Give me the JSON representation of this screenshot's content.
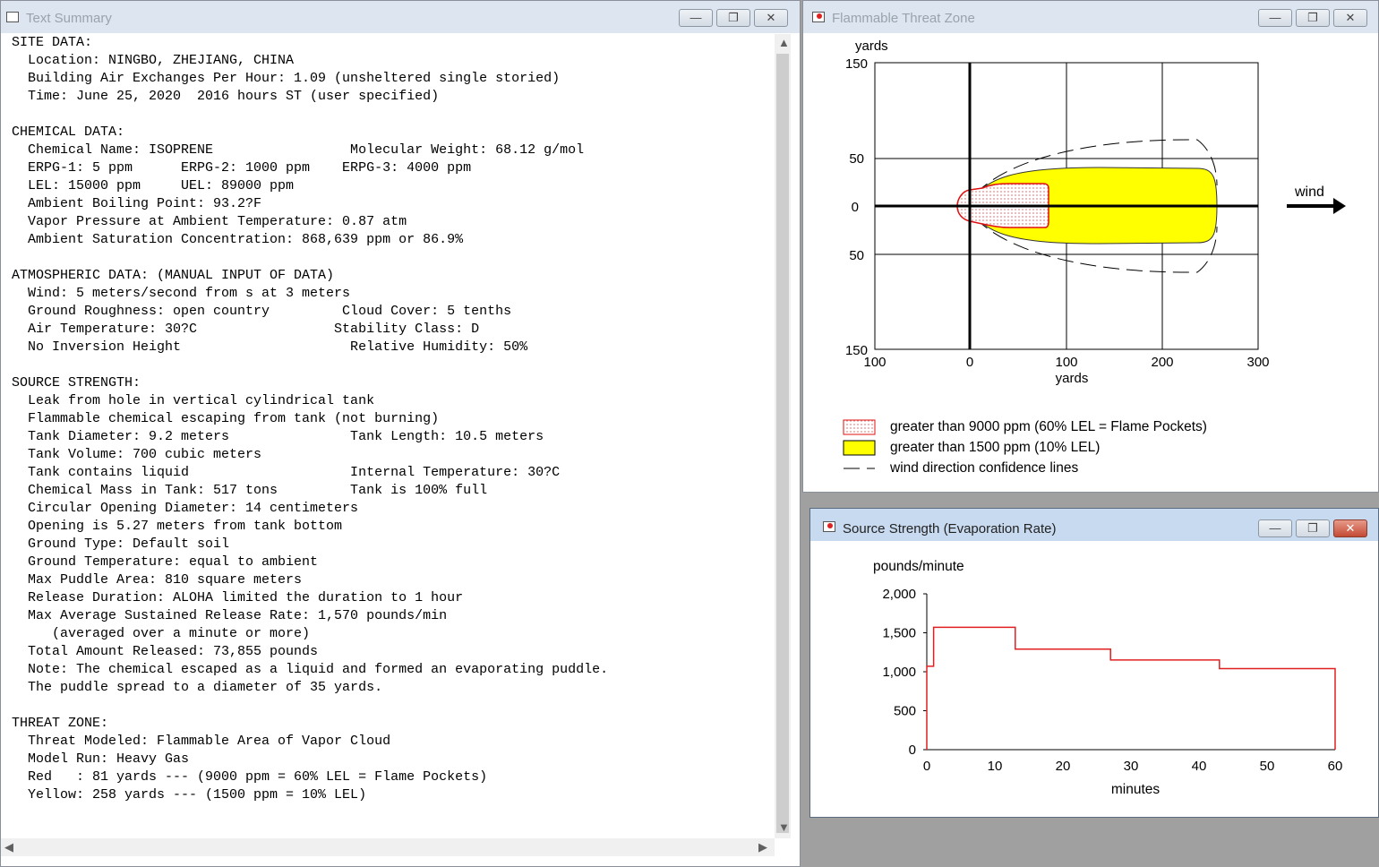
{
  "summary_window": {
    "title": "Text Summary",
    "lines": [
      "SITE DATA:",
      "  Location: NINGBO, ZHEJIANG, CHINA",
      "  Building Air Exchanges Per Hour: 1.09 (unsheltered single storied)",
      "  Time: June 25, 2020  2016 hours ST (user specified)",
      "",
      "CHEMICAL DATA:",
      "  Chemical Name: ISOPRENE                 Molecular Weight: 68.12 g/mol",
      "  ERPG-1: 5 ppm      ERPG-2: 1000 ppm    ERPG-3: 4000 ppm",
      "  LEL: 15000 ppm     UEL: 89000 ppm",
      "  Ambient Boiling Point: 93.2?F",
      "  Vapor Pressure at Ambient Temperature: 0.87 atm",
      "  Ambient Saturation Concentration: 868,639 ppm or 86.9%",
      "",
      "ATMOSPHERIC DATA: (MANUAL INPUT OF DATA)",
      "  Wind: 5 meters/second from s at 3 meters",
      "  Ground Roughness: open country         Cloud Cover: 5 tenths",
      "  Air Temperature: 30?C                 Stability Class: D",
      "  No Inversion Height                     Relative Humidity: 50%",
      "",
      "SOURCE STRENGTH:",
      "  Leak from hole in vertical cylindrical tank",
      "  Flammable chemical escaping from tank (not burning)",
      "  Tank Diameter: 9.2 meters               Tank Length: 10.5 meters",
      "  Tank Volume: 700 cubic meters",
      "  Tank contains liquid                    Internal Temperature: 30?C",
      "  Chemical Mass in Tank: 517 tons         Tank is 100% full",
      "  Circular Opening Diameter: 14 centimeters",
      "  Opening is 5.27 meters from tank bottom",
      "  Ground Type: Default soil",
      "  Ground Temperature: equal to ambient",
      "  Max Puddle Area: 810 square meters",
      "  Release Duration: ALOHA limited the duration to 1 hour",
      "  Max Average Sustained Release Rate: 1,570 pounds/min",
      "     (averaged over a minute or more)",
      "  Total Amount Released: 73,855 pounds",
      "  Note: The chemical escaped as a liquid and formed an evaporating puddle.",
      "  The puddle spread to a diameter of 35 yards.",
      "",
      "THREAT ZONE:",
      "  Threat Modeled: Flammable Area of Vapor Cloud",
      "  Model Run: Heavy Gas",
      "  Red   : 81 yards --- (9000 ppm = 60% LEL = Flame Pockets)",
      "  Yellow: 258 yards --- (1500 ppm = 10% LEL)"
    ]
  },
  "threat_window": {
    "title": "Flammable Threat Zone",
    "y_unit": "yards",
    "x_unit": "yards",
    "y_ticks": [
      "150",
      "50",
      "0",
      "50",
      "150"
    ],
    "x_ticks": [
      "100",
      "0",
      "100",
      "200",
      "300"
    ],
    "wind_label": "wind",
    "legend": [
      {
        "key": "red",
        "label": "greater than 9000 ppm (60% LEL = Flame Pockets)"
      },
      {
        "key": "yellow",
        "label": "greater than 1500 ppm (10% LEL)"
      },
      {
        "key": "dash",
        "label": "wind direction confidence lines"
      }
    ]
  },
  "source_window": {
    "title": "Source Strength (Evaporation Rate)",
    "ylabel": "pounds/minute",
    "xlabel": "minutes",
    "y_ticks": [
      "2,000",
      "1,500",
      "1,000",
      "500",
      "0"
    ],
    "x_ticks": [
      "0",
      "10",
      "20",
      "30",
      "40",
      "50",
      "60"
    ]
  },
  "chart_data": [
    {
      "type": "area",
      "name": "Flammable Threat Zone",
      "x_unit": "yards",
      "y_unit": "yards",
      "xlim": [
        -100,
        300
      ],
      "ylim": [
        -150,
        150
      ],
      "zones": [
        {
          "color": "#ff0000",
          "threshold": "9000 ppm",
          "downwind_extent": 81
        },
        {
          "color": "#ffff00",
          "threshold": "1500 ppm",
          "downwind_extent": 258
        }
      ]
    },
    {
      "type": "line",
      "name": "Source Strength (Evaporation Rate)",
      "xlabel": "minutes",
      "ylabel": "pounds/minute",
      "xlim": [
        0,
        60
      ],
      "ylim": [
        0,
        2000
      ],
      "series": [
        {
          "color": "#e02020",
          "x": [
            0,
            0,
            1,
            1,
            13,
            13,
            27,
            27,
            43,
            43,
            60,
            60
          ],
          "y": [
            0,
            1070,
            1070,
            1570,
            1570,
            1290,
            1290,
            1150,
            1150,
            1040,
            1040,
            0
          ]
        }
      ]
    }
  ]
}
